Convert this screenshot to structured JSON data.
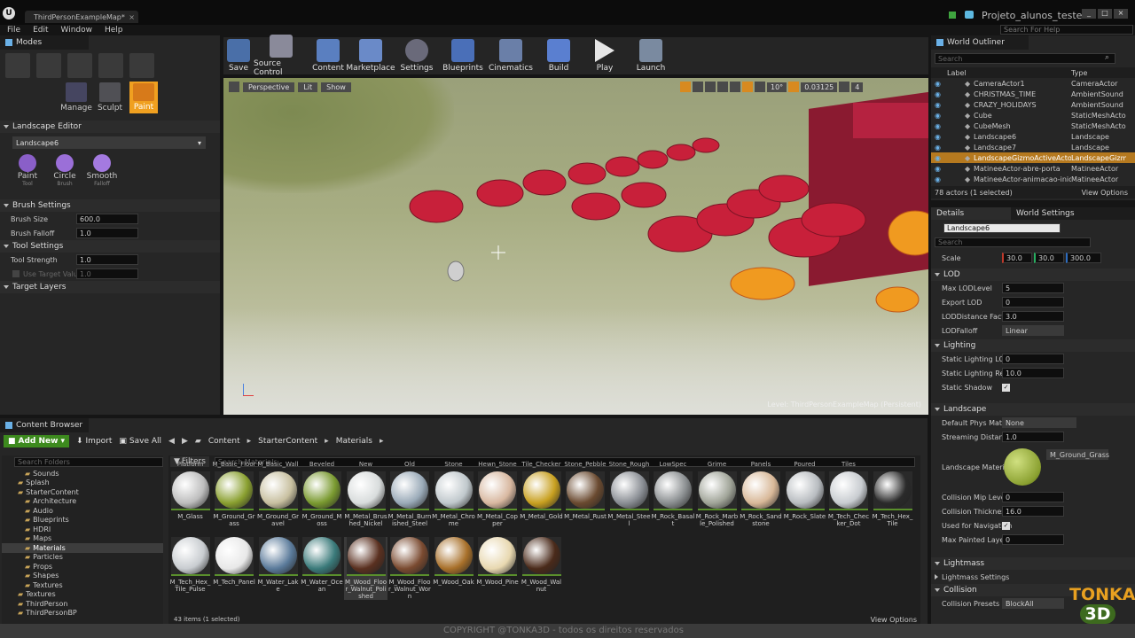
{
  "window": {
    "tab_title": "ThirdPersonExampleMap*",
    "project_name": "Projeto_alunos_teste",
    "help_search": "Search For Help"
  },
  "menu": [
    "File",
    "Edit",
    "Window",
    "Help"
  ],
  "modes": {
    "tab": "Modes",
    "tools": [
      "Manage",
      "Sculpt",
      "Paint"
    ]
  },
  "landscape_editor": {
    "title": "Landscape Editor",
    "selected": "Landscape6",
    "tools": [
      {
        "label": "Paint",
        "sub": "Tool"
      },
      {
        "label": "Circle",
        "sub": "Brush"
      },
      {
        "label": "Smooth",
        "sub": "Falloff"
      }
    ]
  },
  "brush_settings": {
    "title": "Brush Settings",
    "brush_size_label": "Brush Size",
    "brush_size": "600.0",
    "brush_falloff_label": "Brush Falloff",
    "brush_falloff": "1.0"
  },
  "tool_settings": {
    "title": "Tool Settings",
    "tool_strength_label": "Tool Strength",
    "tool_strength": "1.0",
    "target_value_label": "Use Target Value",
    "target_value": "1.0"
  },
  "target_layers": {
    "title": "Target Layers"
  },
  "toolbar": [
    "Save",
    "Source Control",
    "Content",
    "Marketplace",
    "Settings",
    "Blueprints",
    "Cinematics",
    "Build",
    "Play",
    "Launch"
  ],
  "viewport": {
    "perspective": "Perspective",
    "lit": "Lit",
    "show": "Show",
    "angle": "10°",
    "scale": "0.03125",
    "cam": "4",
    "level_label": "Level:",
    "level_name": "ThirdPersonExampleMap (Persistent)"
  },
  "outliner": {
    "tab": "World Outliner",
    "search": "Search",
    "col_label": "Label",
    "col_type": "Type",
    "rows": [
      {
        "label": "CameraActor1",
        "type": "CameraActor"
      },
      {
        "label": "CHRISTMAS_TIME",
        "type": "AmbientSound"
      },
      {
        "label": "CRAZY_HOLIDAYS",
        "type": "AmbientSound"
      },
      {
        "label": "Cube",
        "type": "StaticMeshActo"
      },
      {
        "label": "CubeMesh",
        "type": "StaticMeshActo"
      },
      {
        "label": "Landscape6",
        "type": "Landscape"
      },
      {
        "label": "Landscape7",
        "type": "Landscape"
      },
      {
        "label": "LandscapeGizmoActiveActor2",
        "type": "LandscapeGizm"
      },
      {
        "label": "MatineeActor-abre-porta",
        "type": "MatineeActor"
      },
      {
        "label": "MatineeActor-animacao-inicial",
        "type": "MatineeActor"
      }
    ],
    "count": "78 actors (1 selected)",
    "view_options": "View Options"
  },
  "details": {
    "tab": "Details",
    "tab2": "World Settings",
    "name": "Landscape6",
    "search": "Search",
    "scale_label": "Scale",
    "scale": [
      "30.0",
      "30.0",
      "300.0"
    ],
    "lod_title": "LOD",
    "max_lod_label": "Max LODLevel",
    "max_lod": "5",
    "export_lod_label": "Export LOD",
    "export_lod": "0",
    "lod_dist_label": "LODDistance Facto",
    "lod_dist": "3.0",
    "lod_falloff_label": "LODFalloff",
    "lod_falloff": "Linear",
    "lighting_title": "Lighting",
    "static_lod_label": "Static Lighting LOD",
    "static_lod": "0",
    "static_res_label": "Static Lighting Res",
    "static_res": "10.0",
    "static_shadow_label": "Static Shadow",
    "landscape_title": "Landscape",
    "phys_label": "Default Phys Mater",
    "phys": "None",
    "stream_label": "Streaming Distanc",
    "stream": "1.0",
    "mat_label": "Landscape Materia",
    "mat": "M_Ground_Grass",
    "col_mip_label": "Collision Mip Level",
    "col_mip": "0",
    "col_thick_label": "Collision Thickness",
    "col_thick": "16.0",
    "nav_label": "Used for Navigation",
    "max_painted_label": "Max Painted Layer",
    "max_painted": "0",
    "lightmass_title": "Lightmass",
    "lightmass_settings": "Lightmass Settings",
    "collision_title": "Collision",
    "col_presets_label": "Collision Presets",
    "col_presets": "BlockAll"
  },
  "content_browser": {
    "tab": "Content Browser",
    "add_new": "Add New",
    "import": "Import",
    "save_all": "Save All",
    "path": [
      "Content",
      "StarterContent",
      "Materials"
    ],
    "search_folders": "Search Folders",
    "filters": "Filters",
    "search_materials": "Search Materials",
    "count": "43 items (1 selected)",
    "view_options": "View Options",
    "folders": [
      "Sounds",
      "Splash",
      "StarterContent",
      "Architecture",
      "Audio",
      "Blueprints",
      "HDRI",
      "Maps",
      "Materials",
      "Particles",
      "Props",
      "Shapes",
      "Textures",
      "Textures",
      "ThirdPerson",
      "ThirdPersonBP"
    ],
    "top_labels": [
      "Platform",
      "M_Basic_Floor",
      "M_Basic_Wall",
      "Beveled",
      "New",
      "Old",
      "Stone",
      "Hewn_Stone",
      "Tile_Checker",
      "Stone_Pebble",
      "Stone_Rough",
      "LowSpec",
      "Grime",
      "Panels",
      "Poured",
      "Tiles"
    ],
    "row1": [
      "M_Glass",
      "M_Ground_Grass",
      "M_Ground_Gravel",
      "M_Ground_Moss",
      "M_Metal_Brushed_Nickel",
      "M_Metal_Burnished_Steel",
      "M_Metal_Chrome",
      "M_Metal_Copper",
      "M_Metal_Gold",
      "M_Metal_Rust",
      "M_Metal_Steel",
      "M_Rock_Basalt",
      "M_Rock_Marble_Polished",
      "M_Rock_Sandstone",
      "M_Rock_Slate",
      "M_Tech_Checker_Dot",
      "M_Tech_Hex_Tile"
    ],
    "row2": [
      "M_Tech_Hex_Tile_Pulse",
      "M_Tech_Panel",
      "M_Water_Lake",
      "M_Water_Ocean",
      "M_Wood_Floor_Walnut_Polished",
      "M_Wood_Floor_Walnut_Worn",
      "M_Wood_Oak",
      "M_Wood_Pine",
      "M_Wood_Walnut"
    ]
  },
  "footer": {
    "copyright": "COPYRIGHT @TONKA3D - todos os direitos reservados",
    "logo_top": "TONKA",
    "logo_bottom": "3D"
  },
  "colors": {
    "accent": "#f0a020",
    "selected": "#b5791f",
    "add_new": "#3d8a1e"
  }
}
